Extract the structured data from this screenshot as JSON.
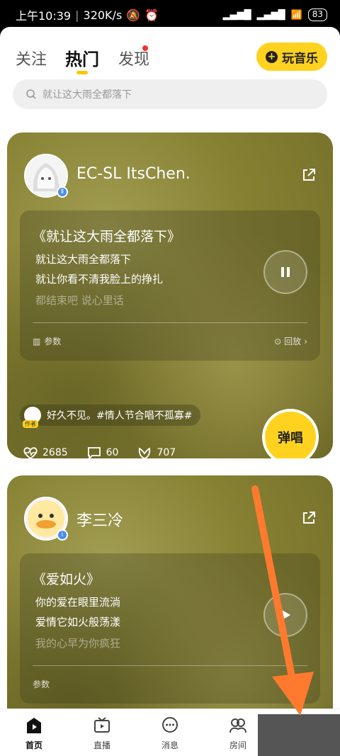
{
  "statusbar": {
    "time": "上午10:39",
    "speed": "320K/s",
    "battery": "83"
  },
  "topnav": {
    "tabs": [
      {
        "label": "关注"
      },
      {
        "label": "热门"
      },
      {
        "label": "发现"
      }
    ],
    "play_button": "玩音乐"
  },
  "search": {
    "placeholder": "就让这大雨全都落下"
  },
  "feed": [
    {
      "username": "EC-SL ItsChen.",
      "song_title": "《就让这大雨全都落下》",
      "lyrics": [
        "就让这大雨全都落下",
        "就让你看不清我脸上的挣扎",
        "都结束吧 说心里话"
      ],
      "meta_left": "参数",
      "meta_right": "回放",
      "author_badge": "作者",
      "author_text": "好久不见。#情人节合唱不孤寡#",
      "likes": "2685",
      "comments": "60",
      "gifts": "707",
      "sing_label": "弹唱"
    },
    {
      "username": "李三冷",
      "song_title": "《爱如火》",
      "lyrics": [
        "你的爱在眼里流淌",
        "爱情它如火般荡漾",
        "我的心早为你疯狂"
      ],
      "meta_left": "参数"
    }
  ],
  "bottomnav": [
    {
      "label": "首页"
    },
    {
      "label": "直播"
    },
    {
      "label": "消息"
    },
    {
      "label": "房间"
    }
  ],
  "colors": {
    "accent": "#ffd21f",
    "card": "#868032",
    "arrow": "#ff7a2f"
  }
}
